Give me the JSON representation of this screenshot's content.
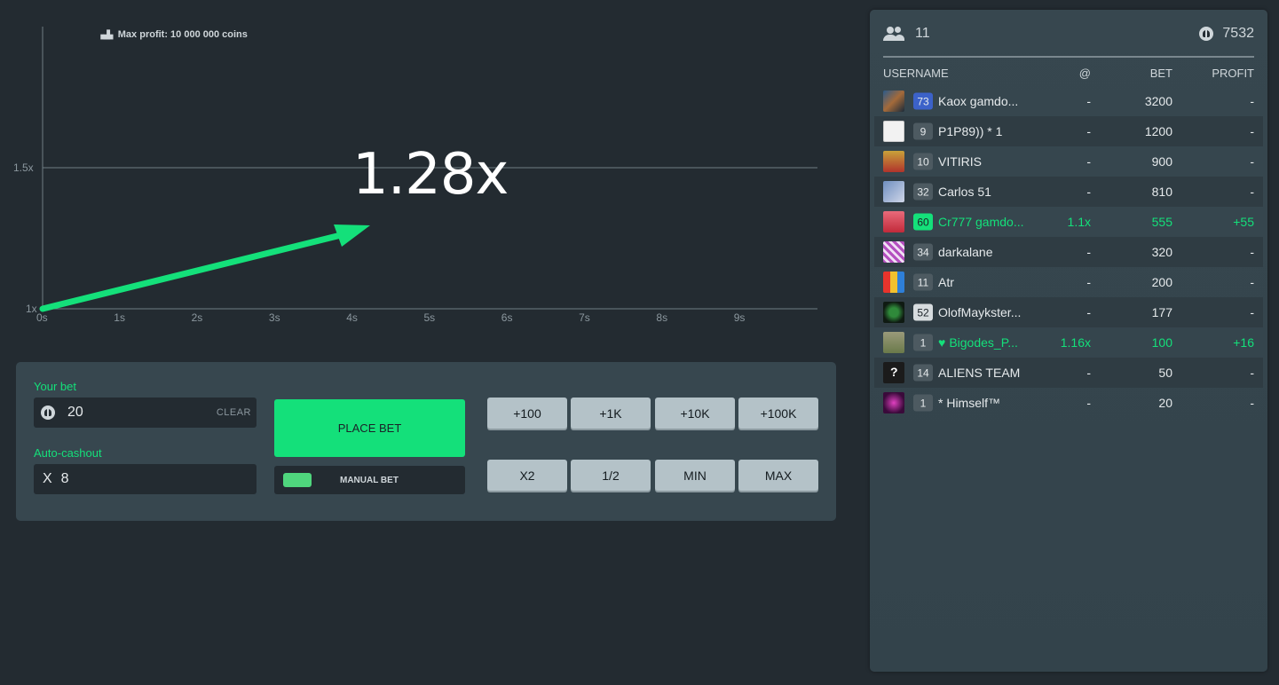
{
  "graph": {
    "max_profit_icon": "trophy-icon",
    "max_profit_text": "Max profit: 10 000 000 coins",
    "multiplier": "1.28x",
    "y_ticks": [
      "1.5x",
      "1x"
    ],
    "x_ticks": [
      "0s",
      "1s",
      "2s",
      "3s",
      "4s",
      "5s",
      "6s",
      "7s",
      "8s",
      "9s"
    ],
    "line_color": "#14e07a"
  },
  "bet_panel": {
    "your_bet_label": "Your bet",
    "bet_value": "20",
    "clear_label": "CLEAR",
    "auto_cashout_label": "Auto-cashout",
    "auto_cashout_prefix": "X",
    "auto_cashout_value": "8",
    "place_bet_label": "PLACE BET",
    "manual_bet_label": "MANUAL BET",
    "quick_buttons": [
      "+100",
      "+1K",
      "+10K",
      "+100K",
      "X2",
      "1/2",
      "MIN",
      "MAX"
    ],
    "accent_color": "#14e07a"
  },
  "players": {
    "online_count": "11",
    "total_bet": "7532",
    "columns": {
      "username": "USERNAME",
      "at": "@",
      "bet": "BET",
      "profit": "PROFIT"
    },
    "rows": [
      {
        "level": "73",
        "username": "Kaox gamdo...",
        "at": "-",
        "bet": "3200",
        "profit": "-"
      },
      {
        "level": "9",
        "username": "P1P89)) * 1",
        "at": "-",
        "bet": "1200",
        "profit": "-"
      },
      {
        "level": "10",
        "username": "VITIRIS",
        "at": "-",
        "bet": "900",
        "profit": "-"
      },
      {
        "level": "32",
        "username": "Carlos 51",
        "at": "-",
        "bet": "810",
        "profit": "-"
      },
      {
        "level": "60",
        "username": "Cr777 gamdo...",
        "at": "1.1x",
        "bet": "555",
        "profit": "+55"
      },
      {
        "level": "34",
        "username": "darkalane",
        "at": "-",
        "bet": "320",
        "profit": "-"
      },
      {
        "level": "11",
        "username": "Atr",
        "at": "-",
        "bet": "200",
        "profit": "-"
      },
      {
        "level": "52",
        "username": "OlofMaykster...",
        "at": "-",
        "bet": "177",
        "profit": "-"
      },
      {
        "level": "1",
        "username": "Bigodes_P...",
        "at": "1.16x",
        "bet": "100",
        "profit": "+16"
      },
      {
        "level": "14",
        "username": "ALIENS TEAM",
        "at": "-",
        "bet": "50",
        "profit": "-"
      },
      {
        "level": "1",
        "username": "* Himself™",
        "at": "-",
        "bet": "20",
        "profit": "-"
      }
    ]
  }
}
